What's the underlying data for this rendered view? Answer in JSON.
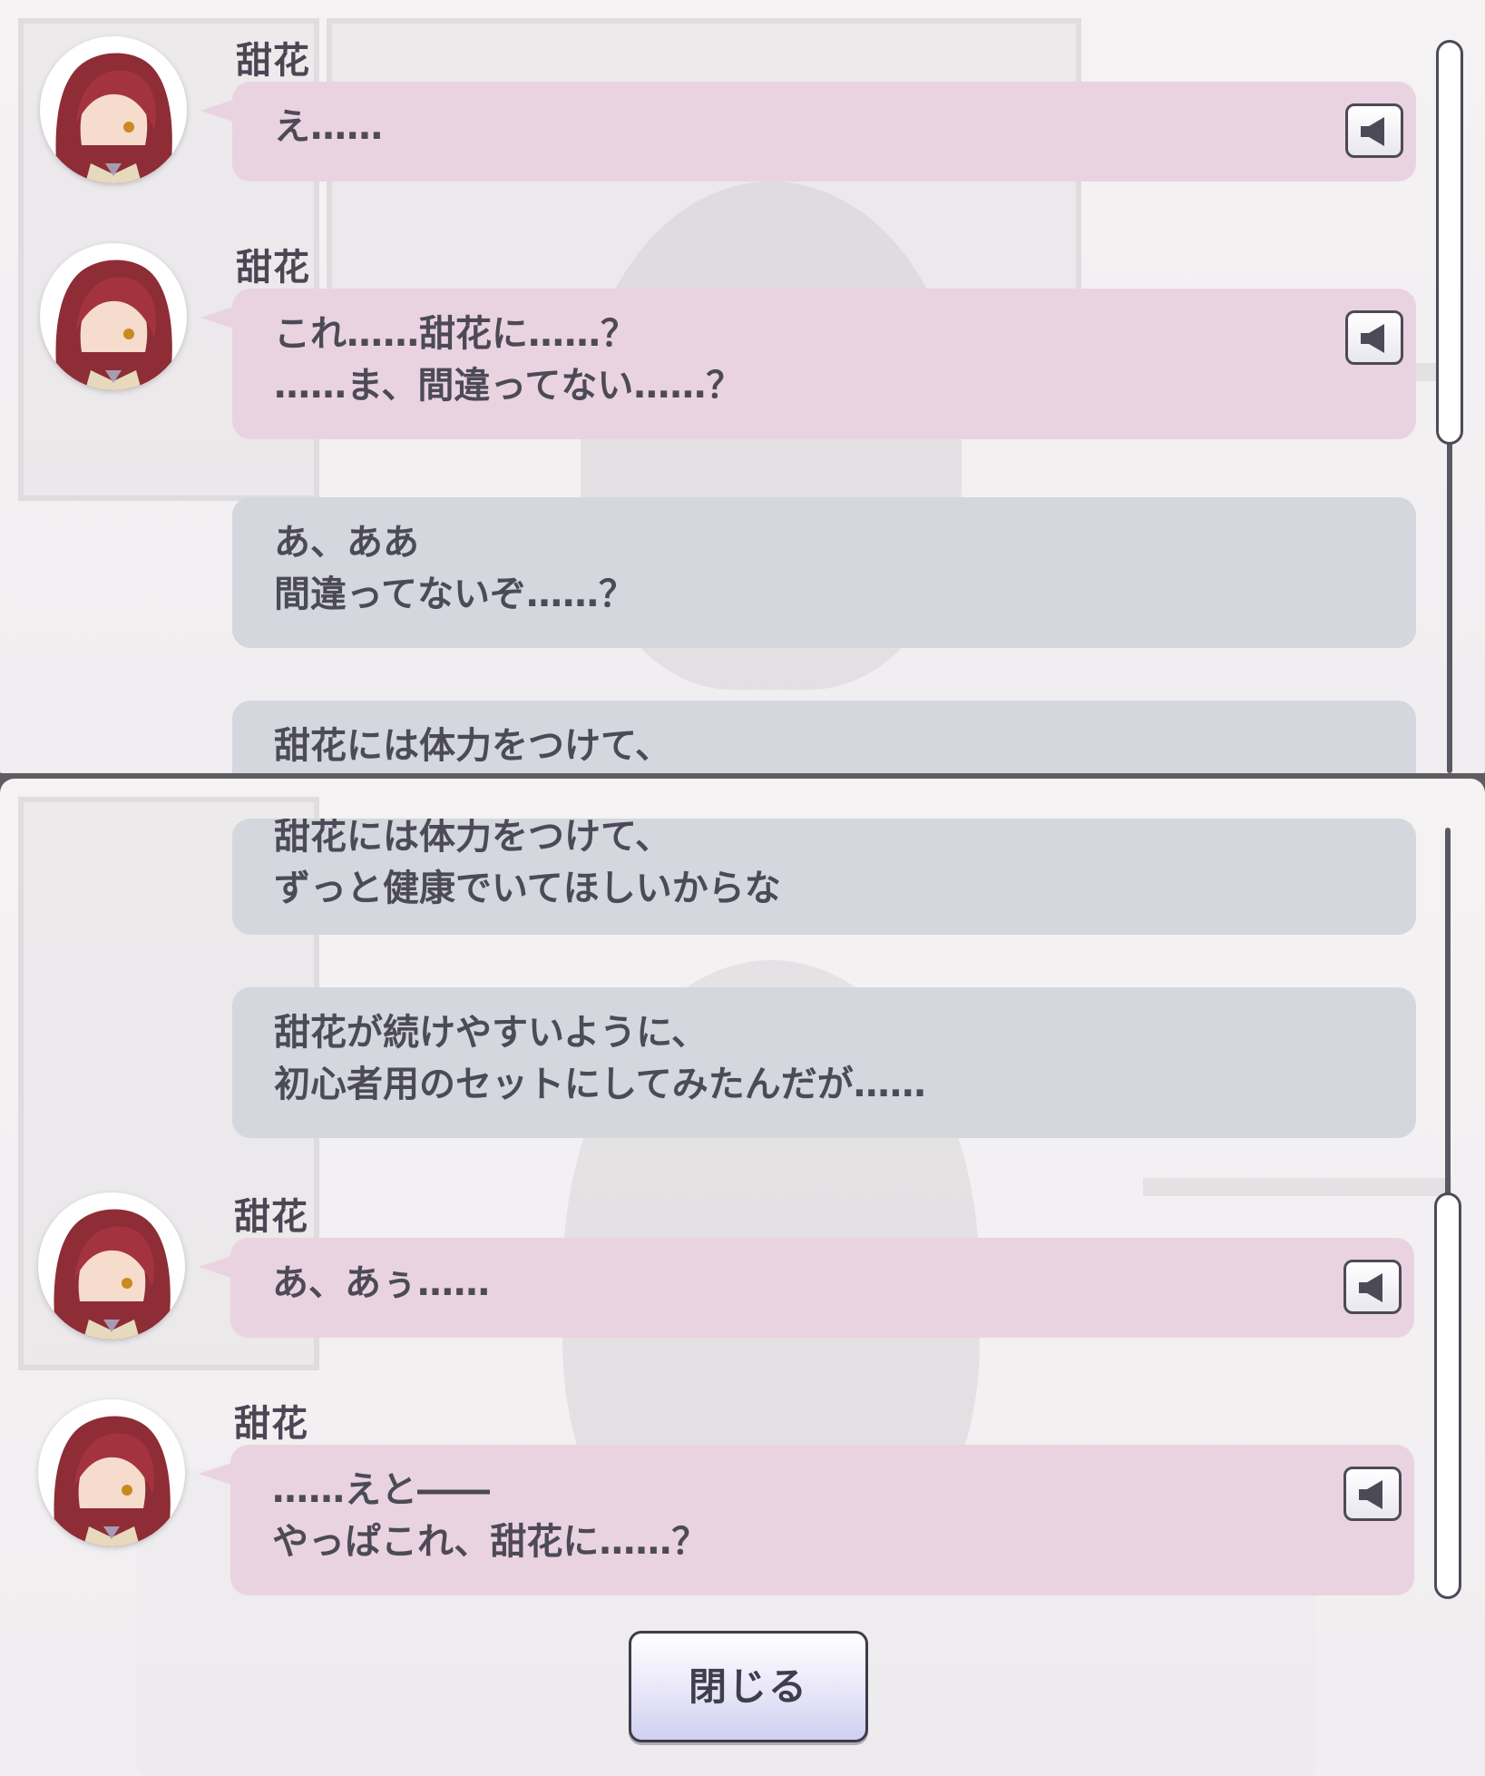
{
  "speaker_name": "甜花",
  "top_panel": {
    "messages": [
      {
        "speaker": "甜花",
        "lines": [
          "え……"
        ]
      },
      {
        "speaker": "甜花",
        "lines": [
          "これ……甜花に……？",
          "……ま、間違ってない……？"
        ]
      },
      {
        "speaker": "",
        "lines": [
          "あ、ああ",
          "間違ってないぞ……？"
        ]
      },
      {
        "speaker": "",
        "lines": [
          "甜花には体力をつけて、"
        ]
      }
    ]
  },
  "bottom_panel": {
    "messages": [
      {
        "speaker": "",
        "lines": [
          "甜花には体力をつけて、",
          "ずっと健康でいてほしいからな"
        ]
      },
      {
        "speaker": "",
        "lines": [
          "甜花が続けやすいように、",
          "初心者用のセットにしてみたんだが……"
        ]
      },
      {
        "speaker": "甜花",
        "lines": [
          "あ、あぅ……"
        ]
      },
      {
        "speaker": "甜花",
        "lines": [
          "……えと――",
          "やっぱこれ、甜花に……？"
        ]
      }
    ]
  },
  "buttons": {
    "close_label": "閉じる"
  },
  "icons": {
    "voice": "speaker-icon",
    "avatar": "character-avatar"
  },
  "colors": {
    "pink_bubble": "#ead3e0",
    "gray_bubble": "#d4d7de",
    "text": "#4d4a58"
  }
}
